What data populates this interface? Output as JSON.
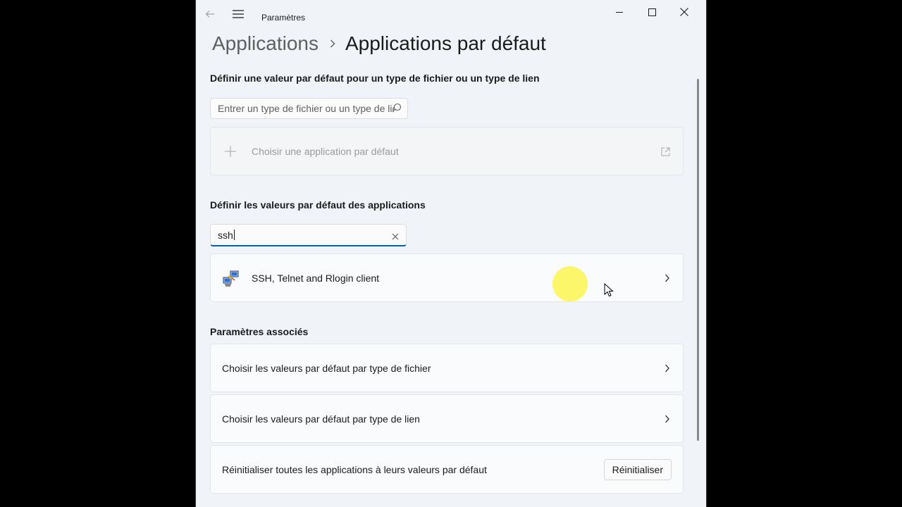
{
  "window": {
    "app_title": "Paramètres",
    "back_icon": "back-arrow-icon",
    "menu_icon": "hamburger-menu-icon"
  },
  "breadcrumb": {
    "parent": "Applications",
    "separator_icon": "chevron-right-icon",
    "current": "Applications par défaut"
  },
  "file_type_section": {
    "title": "Définir une valeur par défaut pour un type de fichier ou un type de lien",
    "search_placeholder": "Entrer un type de fichier ou un type de lien",
    "choose_app_label": "Choisir une application par défaut"
  },
  "apps_section": {
    "title": "Définir les valeurs par défaut des applications",
    "search_value": "ssh",
    "results": [
      {
        "name": "SSH, Telnet and Rlogin client",
        "icon": "network-computers-icon"
      }
    ]
  },
  "related": {
    "title": "Paramètres associés",
    "items": [
      {
        "label": "Choisir les valeurs par défaut par type de fichier"
      },
      {
        "label": "Choisir les valeurs par défaut par type de lien"
      }
    ],
    "reset_label": "Réinitialiser toutes les applications à leurs valeurs par défaut",
    "reset_button": "Réinitialiser"
  },
  "colors": {
    "accent": "#005fb8",
    "background": "#f0f4f8",
    "cursor_highlight": "#faf550"
  }
}
